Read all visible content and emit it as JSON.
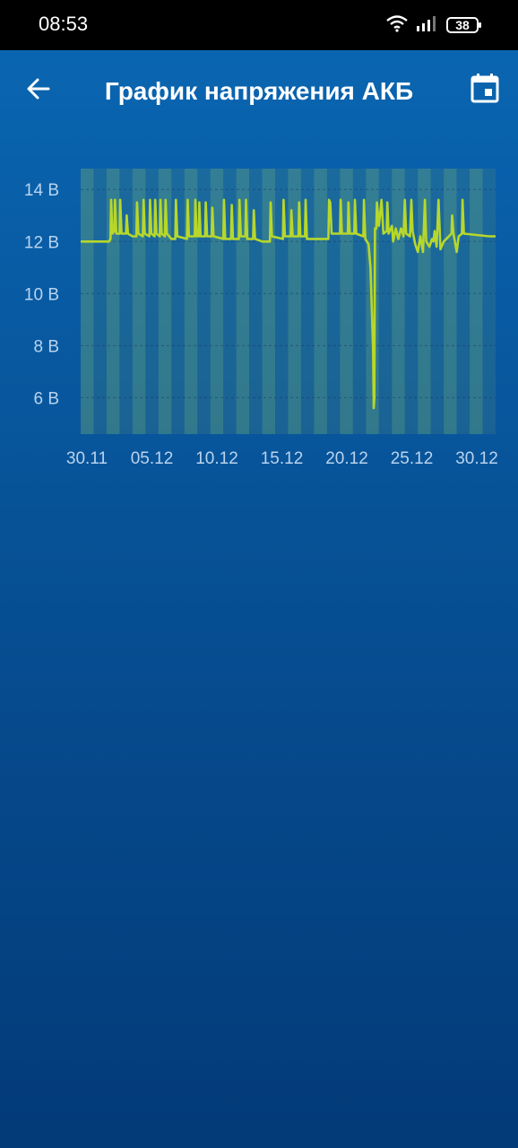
{
  "status_bar": {
    "time": "08:53",
    "battery": "38"
  },
  "header": {
    "title": "График напряжения АКБ"
  },
  "icons": {
    "back": "arrow-left-icon",
    "calendar": "calendar-icon",
    "wifi": "wifi-icon",
    "signal": "signal-icon"
  },
  "colors": {
    "line": "#b7d72b",
    "background_top": "#0a67b3",
    "background_bottom": "#033a78"
  },
  "chart_data": {
    "type": "line",
    "title": "",
    "xlabel": "",
    "ylabel": "",
    "x_ticks": [
      "30.11",
      "05.12",
      "10.12",
      "15.12",
      "20.12",
      "25.12",
      "30.12"
    ],
    "y_ticks": [
      "6 В",
      "8 В",
      "10 В",
      "12 В",
      "14 В"
    ],
    "ylim": [
      4.6,
      14.8
    ],
    "xlim": [
      0,
      32
    ],
    "grid": true,
    "series": [
      {
        "values": [
          [
            0,
            12.0
          ],
          [
            2.2,
            12.0
          ],
          [
            2.3,
            12.1
          ],
          [
            2.35,
            13.6
          ],
          [
            2.45,
            12.3
          ],
          [
            2.6,
            12.4
          ],
          [
            2.65,
            13.6
          ],
          [
            2.75,
            12.3
          ],
          [
            3.0,
            12.3
          ],
          [
            3.05,
            13.6
          ],
          [
            3.15,
            12.3
          ],
          [
            3.5,
            12.3
          ],
          [
            3.55,
            13.0
          ],
          [
            3.65,
            12.3
          ],
          [
            4.0,
            12.2
          ],
          [
            4.3,
            12.2
          ],
          [
            4.35,
            13.5
          ],
          [
            4.45,
            12.3
          ],
          [
            4.8,
            12.2
          ],
          [
            4.85,
            13.6
          ],
          [
            4.95,
            12.3
          ],
          [
            5.3,
            12.2
          ],
          [
            5.35,
            13.6
          ],
          [
            5.45,
            12.3
          ],
          [
            5.7,
            12.2
          ],
          [
            5.75,
            13.6
          ],
          [
            5.85,
            12.3
          ],
          [
            6.1,
            12.2
          ],
          [
            6.15,
            13.6
          ],
          [
            6.25,
            12.3
          ],
          [
            6.5,
            12.2
          ],
          [
            6.55,
            13.6
          ],
          [
            6.65,
            12.3
          ],
          [
            7.0,
            12.1
          ],
          [
            7.3,
            12.1
          ],
          [
            7.35,
            13.6
          ],
          [
            7.45,
            12.2
          ],
          [
            8.2,
            12.1
          ],
          [
            8.25,
            13.6
          ],
          [
            8.35,
            12.2
          ],
          [
            8.8,
            12.2
          ],
          [
            8.85,
            13.6
          ],
          [
            8.95,
            12.2
          ],
          [
            9.1,
            12.2
          ],
          [
            9.15,
            13.5
          ],
          [
            9.25,
            12.2
          ],
          [
            9.6,
            12.2
          ],
          [
            9.65,
            13.5
          ],
          [
            9.75,
            12.2
          ],
          [
            10.1,
            12.2
          ],
          [
            10.15,
            13.3
          ],
          [
            10.25,
            12.2
          ],
          [
            11.0,
            12.1
          ],
          [
            11.05,
            13.6
          ],
          [
            11.15,
            12.1
          ],
          [
            11.6,
            12.1
          ],
          [
            11.65,
            13.4
          ],
          [
            11.75,
            12.1
          ],
          [
            12.2,
            12.1
          ],
          [
            12.25,
            13.6
          ],
          [
            12.35,
            12.2
          ],
          [
            12.7,
            12.2
          ],
          [
            12.75,
            13.6
          ],
          [
            12.85,
            12.1
          ],
          [
            13.3,
            12.1
          ],
          [
            13.35,
            13.2
          ],
          [
            13.45,
            12.1
          ],
          [
            14.0,
            12.0
          ],
          [
            14.6,
            12.0
          ],
          [
            14.65,
            13.5
          ],
          [
            14.75,
            12.2
          ],
          [
            15.6,
            12.1
          ],
          [
            15.65,
            13.6
          ],
          [
            15.75,
            12.2
          ],
          [
            16.2,
            12.2
          ],
          [
            16.25,
            13.2
          ],
          [
            16.35,
            12.2
          ],
          [
            16.8,
            12.2
          ],
          [
            16.85,
            13.5
          ],
          [
            16.95,
            12.2
          ],
          [
            17.3,
            12.2
          ],
          [
            17.35,
            13.6
          ],
          [
            17.45,
            12.1
          ],
          [
            18.0,
            12.1
          ],
          [
            19.1,
            12.1
          ],
          [
            19.15,
            13.6
          ],
          [
            19.25,
            13.5
          ],
          [
            19.35,
            12.3
          ],
          [
            19.8,
            12.3
          ],
          [
            20.0,
            12.3
          ],
          [
            20.05,
            13.6
          ],
          [
            20.15,
            12.3
          ],
          [
            20.6,
            12.3
          ],
          [
            20.65,
            13.5
          ],
          [
            20.75,
            12.3
          ],
          [
            21.1,
            12.3
          ],
          [
            21.15,
            13.6
          ],
          [
            21.25,
            12.3
          ],
          [
            21.8,
            12.2
          ],
          [
            21.85,
            13.6
          ],
          [
            21.95,
            12.1
          ],
          [
            22.2,
            11.9
          ],
          [
            22.35,
            11.0
          ],
          [
            22.45,
            9.5
          ],
          [
            22.55,
            7.8
          ],
          [
            22.6,
            5.6
          ],
          [
            22.65,
            6.0
          ],
          [
            22.7,
            12.5
          ],
          [
            22.8,
            12.5
          ],
          [
            22.85,
            13.5
          ],
          [
            23.0,
            12.6
          ],
          [
            23.2,
            13.6
          ],
          [
            23.35,
            12.3
          ],
          [
            23.6,
            12.4
          ],
          [
            23.65,
            13.5
          ],
          [
            23.75,
            12.3
          ],
          [
            24.0,
            12.6
          ],
          [
            24.1,
            12.0
          ],
          [
            24.3,
            12.5
          ],
          [
            24.5,
            12.1
          ],
          [
            24.7,
            12.5
          ],
          [
            24.9,
            12.2
          ],
          [
            25.0,
            13.6
          ],
          [
            25.1,
            12.3
          ],
          [
            25.4,
            12.2
          ],
          [
            25.5,
            13.6
          ],
          [
            25.6,
            12.4
          ],
          [
            25.8,
            11.9
          ],
          [
            26.0,
            11.6
          ],
          [
            26.2,
            12.2
          ],
          [
            26.4,
            11.6
          ],
          [
            26.55,
            13.6
          ],
          [
            26.65,
            12.0
          ],
          [
            26.9,
            11.8
          ],
          [
            27.1,
            12.1
          ],
          [
            27.2,
            12.0
          ],
          [
            27.3,
            12.4
          ],
          [
            27.45,
            11.8
          ],
          [
            27.6,
            13.6
          ],
          [
            27.75,
            11.7
          ],
          [
            28.0,
            12.0
          ],
          [
            28.2,
            12.1
          ],
          [
            28.6,
            12.3
          ],
          [
            28.65,
            13.0
          ],
          [
            28.75,
            12.3
          ],
          [
            29.0,
            11.6
          ],
          [
            29.15,
            12.2
          ],
          [
            29.4,
            12.3
          ],
          [
            29.45,
            13.6
          ],
          [
            29.55,
            12.3
          ],
          [
            31.5,
            12.2
          ],
          [
            32.0,
            12.2
          ]
        ]
      }
    ]
  }
}
